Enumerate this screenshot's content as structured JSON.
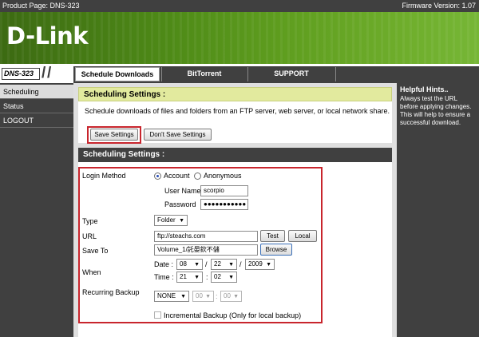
{
  "topbar": {
    "product_label": "Product Page: DNS-323",
    "firmware_label": "Firmware Version: 1.07"
  },
  "brand": {
    "logo_text": "D-Link"
  },
  "model": {
    "name": "DNS-323"
  },
  "tabs": [
    {
      "label": "Schedule Downloads",
      "active": true
    },
    {
      "label": "BitTorrent",
      "active": false
    },
    {
      "label": "SUPPORT",
      "active": false
    }
  ],
  "sidebar": {
    "items": [
      {
        "label": "Scheduling",
        "active": true
      },
      {
        "label": "Status",
        "active": false
      },
      {
        "label": "LOGOUT",
        "active": false
      }
    ]
  },
  "hints": {
    "title": "Helpful Hints..",
    "text": "Always test the URL before applying changes. This will help to ensure a successful download."
  },
  "scheduling_panel": {
    "title": "Scheduling Settings :",
    "description": "Schedule downloads of files and folders from an FTP server, web server, or local network share.",
    "save_label": "Save Settings",
    "dont_save_label": "Don't Save Settings"
  },
  "form": {
    "title": "Scheduling Settings :",
    "login_method_label": "Login Method",
    "login_options": [
      "Account",
      "Anonymous"
    ],
    "login_selected": "Account",
    "user_name_label": "User Name",
    "user_name_value": "scorpio",
    "password_label": "Password",
    "password_value": "●●●●●●●●●●●",
    "type_label": "Type",
    "type_value": "Folder",
    "url_label": "URL",
    "url_value": "ftp://steachs.com",
    "test_label": "Test",
    "local_label": "Local",
    "save_to_label": "Save To",
    "save_to_value": "Volume_1/託晏欽不儲",
    "browse_label": "Browse",
    "when_label": "When",
    "date_label": "Date :",
    "date_month": "08",
    "date_day": "22",
    "date_year": "2009",
    "time_label": "Time :",
    "time_hour": "21",
    "time_minute": "02",
    "date_sep": "/",
    "time_sep": ":",
    "recurring_label": "Recurring Backup",
    "recurring_value": "NONE",
    "recurring_hour": "00",
    "recurring_minute": "00",
    "incremental_label": "Incremental Backup (Only for local backup)"
  },
  "colors": {
    "accent_red": "#c8252d",
    "brand_green": "#5f9e1f",
    "hint_header": "#e2ea9e",
    "dark_gray": "#404040"
  }
}
